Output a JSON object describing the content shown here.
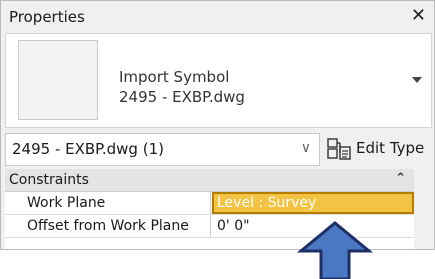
{
  "panel": {
    "title": "Properties",
    "close_glyph": "✕"
  },
  "type_selector": {
    "line1": "Import Symbol",
    "line2": "2495 - EXBP.dwg",
    "dropdown_icon": "caret-down-icon"
  },
  "instance_selector": {
    "value": "2495 - EXBP.dwg (1)",
    "chevron": "∨"
  },
  "edit_type": {
    "label": "Edit Type",
    "icon": "edit-type-icon"
  },
  "groups": [
    {
      "label": "Constraints",
      "collapse_glyph": "⌃",
      "rows": [
        {
          "name": "Work Plane",
          "value": "Level : Survey",
          "highlighted": true
        },
        {
          "name": "Offset from Work Plane",
          "value": "0'  0\"",
          "highlighted": false
        }
      ]
    }
  ],
  "annotation": {
    "arrow_icon": "up-arrow-icon",
    "color": "#4a78c2",
    "outline": "#1d2f66"
  },
  "colors": {
    "highlight_fill": "#f3c343",
    "highlight_border": "#b47d00"
  }
}
